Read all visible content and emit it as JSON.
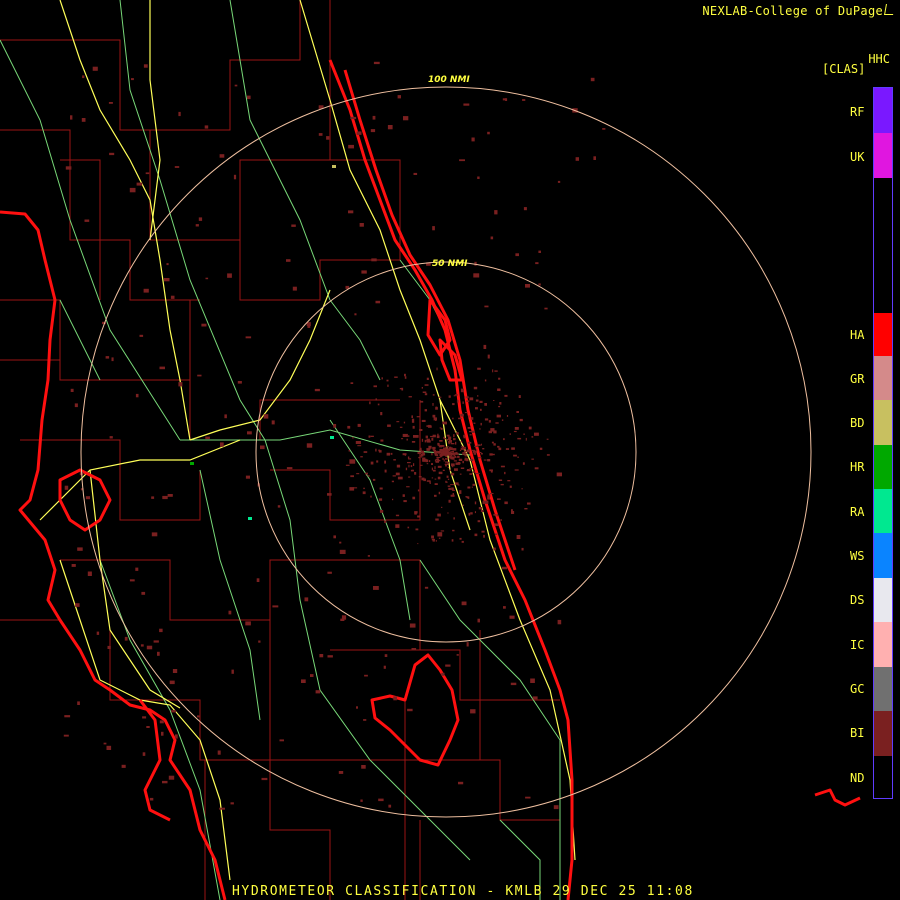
{
  "credit": "NEXLAB-College of DuPage",
  "product_code": "HHC",
  "legend_unit": "[CLAS]",
  "footer": "HYDROMETEOR CLASSIFICATION - KMLB 29 DEC 25 11:08",
  "range_rings": [
    {
      "label": "100 NMI"
    },
    {
      "label": "50 NMI"
    }
  ],
  "classes": [
    {
      "code": "RF",
      "color": "#7a18ff"
    },
    {
      "code": "UK",
      "color": "#e016e0"
    },
    {
      "code": "HA",
      "color": "#ff0000"
    },
    {
      "code": "GR",
      "color": "#d48a8a"
    },
    {
      "code": "BD",
      "color": "#c8c060"
    },
    {
      "code": "HR",
      "color": "#00a800"
    },
    {
      "code": "RA",
      "color": "#00e890"
    },
    {
      "code": "WS",
      "color": "#0a84ff"
    },
    {
      "code": "DS",
      "color": "#e8e8ee"
    },
    {
      "code": "IC",
      "color": "#ffb0b0"
    },
    {
      "code": "GC",
      "color": "#707070"
    },
    {
      "code": "BI",
      "color": "#7a2020"
    },
    {
      "code": "ND",
      "color": "#000000"
    }
  ],
  "colors": {
    "coastline": "#ff1010",
    "county_lines": "#a01818",
    "highways": "#ffff60",
    "roads": "#80e080",
    "rings": "#f0c0a0",
    "echo_bi": "#7a2020"
  }
}
